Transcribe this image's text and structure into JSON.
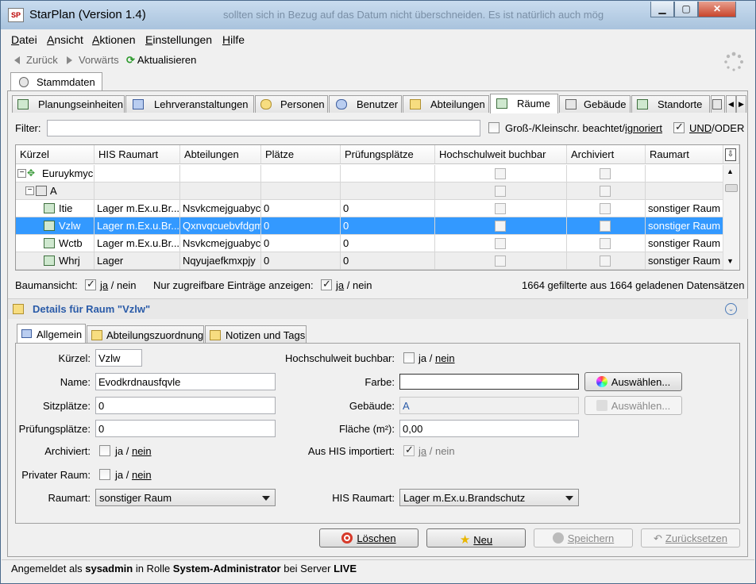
{
  "window": {
    "title": "StarPlan (Version 1.4)",
    "bg_text": "sollten sich in Bezug auf das Datum nicht überschneiden. Es ist natürlich auch mög",
    "appicon": "SP"
  },
  "menu": [
    "Datei",
    "Ansicht",
    "Aktionen",
    "Einstellungen",
    "Hilfe"
  ],
  "nav": {
    "back": "Zurück",
    "forward": "Vorwärts",
    "refresh": "Aktualisieren"
  },
  "top_tab": "Stammdaten",
  "tabs": [
    "Planungseinheiten",
    "Lehrveranstaltungen",
    "Personen",
    "Benutzer",
    "Abteilungen",
    "Räume",
    "Gebäude",
    "Standorte"
  ],
  "selected_tab": "Räume",
  "filter": {
    "label": "Filter:",
    "value": "",
    "case_label_1": "Groß-/Kleinschr. beachtet/",
    "case_label_2": "ignoriert",
    "case_checked": false,
    "and_label_1": "UND",
    "and_label_2": "/ODER",
    "and_checked": true
  },
  "grid": {
    "columns": [
      "Kürzel",
      "HIS Raumart",
      "Abteilungen",
      "Plätze",
      "Prüfungsplätze",
      "Hochschulweit buchbar",
      "Archiviert",
      "Raumart"
    ],
    "rows": [
      {
        "kuerzel": "Euruykmyc",
        "his": "",
        "abt": "",
        "plaetze": "",
        "pruef": "",
        "raumart": ""
      },
      {
        "kuerzel": "A",
        "his": "",
        "abt": "",
        "plaetze": "",
        "pruef": "",
        "raumart": ""
      },
      {
        "kuerzel": "Itie",
        "his": "Lager m.Ex.u.Br...",
        "abt": "Nsvkcmejguabyc",
        "plaetze": "0",
        "pruef": "0",
        "raumart": "sonstiger Raum"
      },
      {
        "kuerzel": "Vzlw",
        "his": "Lager m.Ex.u.Br...",
        "abt": "Qxnvqcuebvfdgm",
        "plaetze": "0",
        "pruef": "0",
        "raumart": "sonstiger Raum"
      },
      {
        "kuerzel": "Wctb",
        "his": "Lager m.Ex.u.Br...",
        "abt": "Nsvkcmejguabyc",
        "plaetze": "0",
        "pruef": "0",
        "raumart": "sonstiger Raum"
      },
      {
        "kuerzel": "Whrj",
        "his": "Lager",
        "abt": "Nqyujaefkmxpjy",
        "plaetze": "0",
        "pruef": "0",
        "raumart": "sonstiger Raum"
      }
    ]
  },
  "options": {
    "baum_label": "Baumansicht:",
    "ja": "ja",
    "slash_nein": " / nein",
    "zugreif_label": "Nur zugreifbare Einträge anzeigen:",
    "count_text": "1664 gefilterte aus 1664 geladenen Datensätzen"
  },
  "details": {
    "title": "Details für Raum \"Vzlw\"",
    "tabs": [
      "Allgemein",
      "Abteilungszuordnung",
      "Notizen und Tags"
    ],
    "labels": {
      "kuerzel": "Kürzel:",
      "name": "Name:",
      "sitz": "Sitzplätze:",
      "pruef": "Prüfungsplätze:",
      "arch": "Archiviert:",
      "priv": "Privater Raum:",
      "raumart": "Raumart:",
      "hoch": "Hochschulweit buchbar:",
      "farbe": "Farbe:",
      "geb": "Gebäude:",
      "flaeche": "Fläche (m²):",
      "his_imp": "Aus HIS importiert:",
      "his_raumart": "HIS Raumart:"
    },
    "values": {
      "kuerzel": "Vzlw",
      "name": "Evodkrdnausfqvle",
      "sitz": "0",
      "pruef": "0",
      "farbe": "",
      "geb": "A",
      "flaeche": "0,00",
      "raumart": "sonstiger Raum",
      "his_raumart": "Lager m.Ex.u.Brandschutz"
    },
    "ja": "ja",
    "slash": " / ",
    "nein": "nein",
    "choose": "Auswählen..."
  },
  "buttons": {
    "delete": "Löschen",
    "new": "Neu",
    "save": "Speichern",
    "reset": "Zurücksetzen"
  },
  "status": {
    "p1": "Angemeldet als ",
    "user": "sysadmin",
    "p2": " in Rolle ",
    "role": "System-Administrator",
    "p3": " bei Server ",
    "server": "LIVE"
  }
}
